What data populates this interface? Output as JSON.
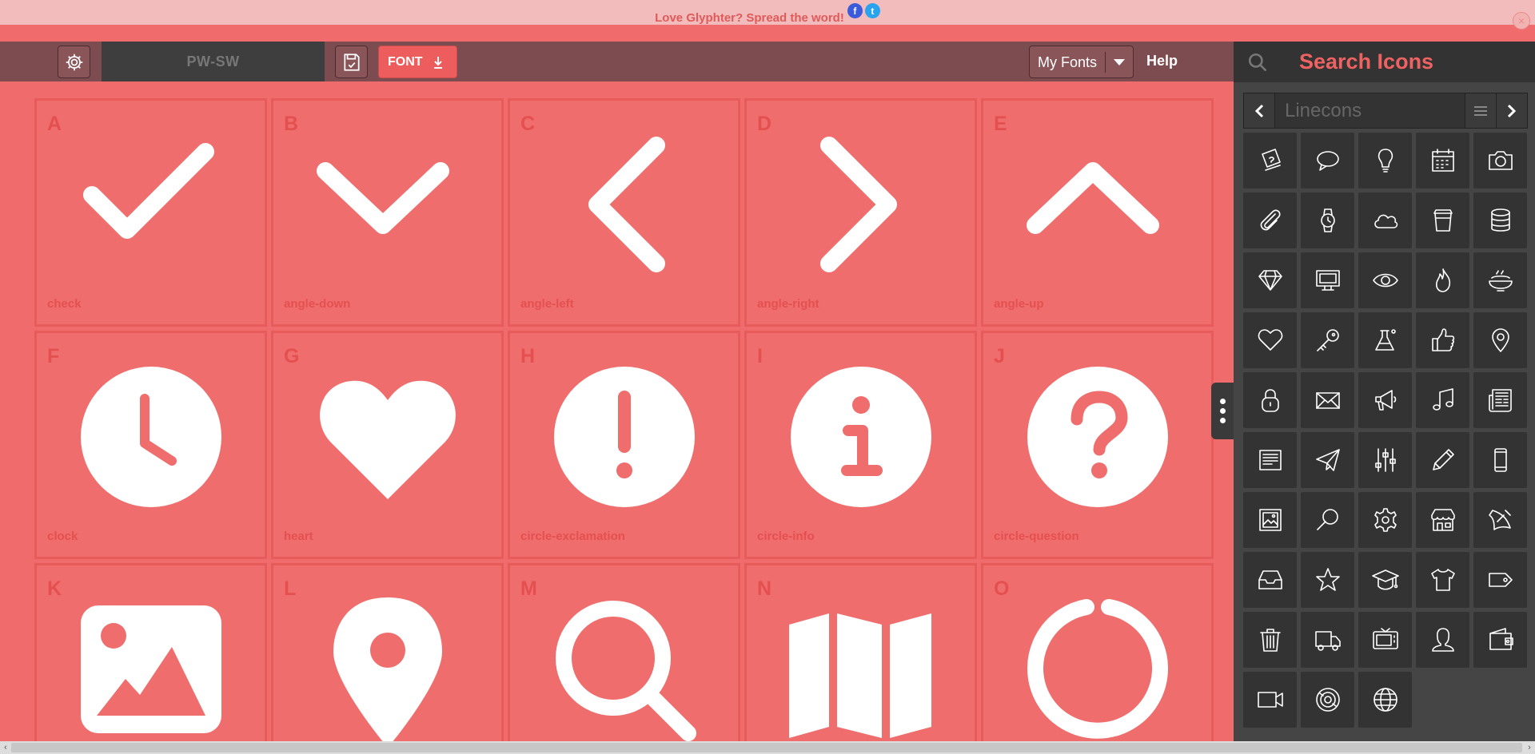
{
  "banner": {
    "text": "Love Glyphter? Spread the word!",
    "facebook": "f",
    "twitter": "t",
    "close": "×"
  },
  "toolbar": {
    "font_name": "PW-SW",
    "font_button_label": "FONT",
    "my_fonts_label": "My Fonts",
    "help_label": "Help"
  },
  "glyphs": [
    {
      "letter": "A",
      "name": "check"
    },
    {
      "letter": "B",
      "name": "angle-down"
    },
    {
      "letter": "C",
      "name": "angle-left"
    },
    {
      "letter": "D",
      "name": "angle-right"
    },
    {
      "letter": "E",
      "name": "angle-up"
    },
    {
      "letter": "F",
      "name": "clock"
    },
    {
      "letter": "G",
      "name": "heart"
    },
    {
      "letter": "H",
      "name": "circle-exclamation"
    },
    {
      "letter": "I",
      "name": "circle-info"
    },
    {
      "letter": "J",
      "name": "circle-question"
    },
    {
      "letter": "K",
      "name": ""
    },
    {
      "letter": "L",
      "name": ""
    },
    {
      "letter": "M",
      "name": ""
    },
    {
      "letter": "N",
      "name": ""
    },
    {
      "letter": "O",
      "name": ""
    }
  ],
  "panel": {
    "title": "Search Icons",
    "icon_set": "Linecons",
    "icons": [
      "ticket-icon",
      "comment-icon",
      "bulb-icon",
      "calendar-icon",
      "camera-icon",
      "paperclip-icon",
      "watch-icon",
      "cloud-icon",
      "cup-icon",
      "database-icon",
      "diamond-icon",
      "desktop-icon",
      "eye-icon",
      "fire-icon",
      "food-icon",
      "heart-icon",
      "key-icon",
      "lab-icon",
      "like-icon",
      "location-icon",
      "lock-icon",
      "mail-icon",
      "megaphone-icon",
      "music-icon",
      "news-icon",
      "note-icon",
      "paperplane-icon",
      "params-icon",
      "pencil-icon",
      "phone-icon",
      "photo-icon",
      "search-icon",
      "settings-icon",
      "shop-icon",
      "sound-icon",
      "stack-icon",
      "star-icon",
      "study-icon",
      "tshirt-icon",
      "tag-icon",
      "trash-icon",
      "truck-icon",
      "tv-icon",
      "user-icon",
      "wallet-icon",
      "video-icon",
      "vynil-icon",
      "world-icon"
    ]
  },
  "colors": {
    "accent": "#f06b6b",
    "panel": "#454545",
    "toolbar": "#7d4c50"
  }
}
